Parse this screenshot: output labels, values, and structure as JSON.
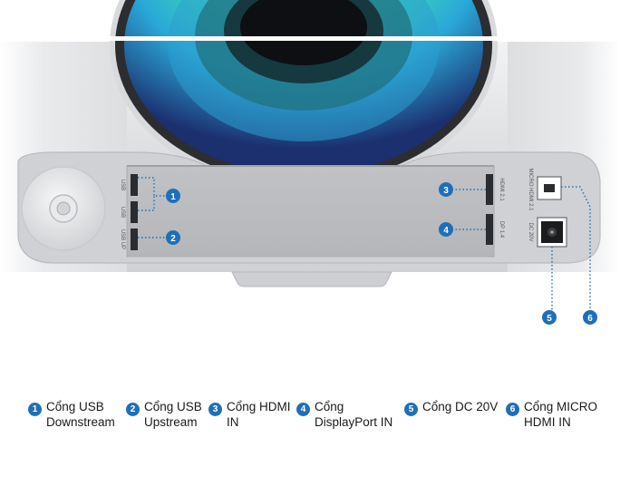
{
  "colors": {
    "accent_blue": "#1f6fb8",
    "body_silver": "#d7d8da",
    "panel_grey": "#c3c5c8",
    "ring_glow": "#3fe0b0"
  },
  "port_labels": {
    "usb_top": "USB",
    "usb_bottom": "USB",
    "usb_up": "USB UP",
    "hdmi": "HDMI 2.1",
    "dp": "DP 1.4",
    "micro_hdmi": "MICRO HDMI 2.1",
    "dc": "DC 20V"
  },
  "callouts": [
    "1",
    "2",
    "3",
    "4",
    "5",
    "6"
  ],
  "legend": [
    {
      "num": "1",
      "text": "Cổng USB\nDownstream"
    },
    {
      "num": "2",
      "text": "Cổng USB\nUpstream"
    },
    {
      "num": "3",
      "text": "Cổng HDMI\nIN"
    },
    {
      "num": "4",
      "text": "Cổng\nDisplayPort IN"
    },
    {
      "num": "5",
      "text": "Cổng DC 20V"
    },
    {
      "num": "6",
      "text": "Cổng MICRO\nHDMI IN"
    }
  ]
}
